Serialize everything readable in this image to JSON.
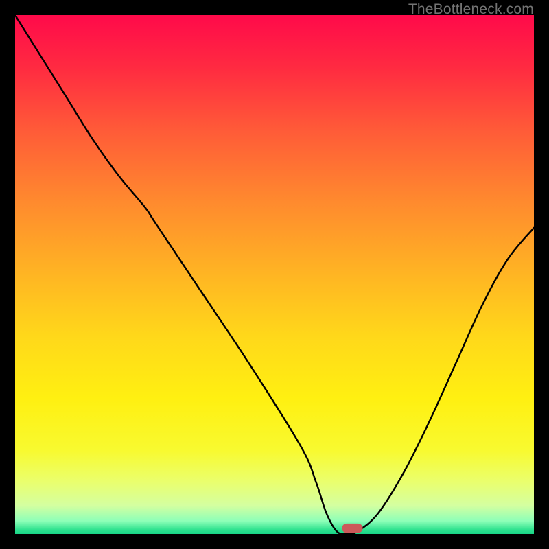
{
  "watermark": "TheBottleneck.com",
  "colors": {
    "page_bg": "#000000",
    "curve": "#000000",
    "marker": "#cc5a5a"
  },
  "gradient_stops": [
    {
      "offset": 0.0,
      "color": "#ff0a4a"
    },
    {
      "offset": 0.1,
      "color": "#ff2a41"
    },
    {
      "offset": 0.22,
      "color": "#ff5a38"
    },
    {
      "offset": 0.36,
      "color": "#ff8a2e"
    },
    {
      "offset": 0.5,
      "color": "#ffb523"
    },
    {
      "offset": 0.62,
      "color": "#ffd81a"
    },
    {
      "offset": 0.74,
      "color": "#fff011"
    },
    {
      "offset": 0.84,
      "color": "#f8fa30"
    },
    {
      "offset": 0.9,
      "color": "#eaff6e"
    },
    {
      "offset": 0.945,
      "color": "#d4ffa0"
    },
    {
      "offset": 0.975,
      "color": "#8effb8"
    },
    {
      "offset": 0.992,
      "color": "#2fe28f"
    },
    {
      "offset": 1.0,
      "color": "#17d487"
    }
  ],
  "chart_data": {
    "type": "line",
    "title": "",
    "xlabel": "",
    "ylabel": "",
    "xlim": [
      0,
      100
    ],
    "ylim": [
      0,
      100
    ],
    "x": [
      0,
      5,
      10,
      15,
      20,
      25,
      27,
      35,
      45,
      55,
      58,
      60,
      62,
      64,
      66,
      70,
      75,
      80,
      85,
      90,
      95,
      100
    ],
    "y": [
      100,
      92,
      84,
      76,
      69,
      63,
      60,
      48,
      33,
      17,
      10,
      4,
      0.5,
      0,
      0.5,
      4,
      12,
      22,
      33,
      44,
      53,
      59
    ],
    "optimal_x": 64,
    "marker": {
      "x": 63,
      "width": 4,
      "y": 0.2,
      "height": 1.8
    }
  }
}
